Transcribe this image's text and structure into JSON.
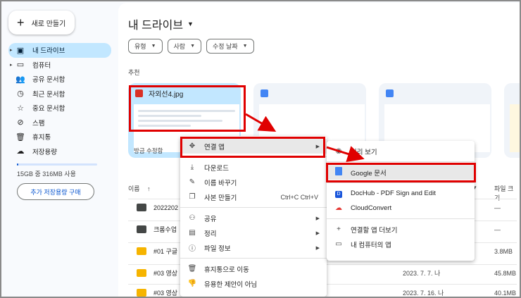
{
  "sidebar": {
    "new_button": "새로 만들기",
    "items": [
      {
        "label": "내 드라이브",
        "icon": "drive-icon"
      },
      {
        "label": "컴퓨터",
        "icon": "computer-icon"
      },
      {
        "label": "공유 문서함",
        "icon": "shared-icon"
      },
      {
        "label": "최근 문서함",
        "icon": "clock-icon"
      },
      {
        "label": "중요 문서함",
        "icon": "star-icon"
      },
      {
        "label": "스팸",
        "icon": "spam-icon"
      },
      {
        "label": "휴지통",
        "icon": "trash-icon"
      },
      {
        "label": "저장용량",
        "icon": "cloud-icon"
      }
    ],
    "storage_text": "15GB 중 316MB 사용",
    "storage_fraction": 0.021,
    "buy_button": "추가 저장용량 구매"
  },
  "main": {
    "title": "내 드라이브",
    "chips": [
      "유형",
      "사람",
      "수정 날짜"
    ],
    "suggested_label": "추천",
    "card": {
      "name": "자외선4.jpg",
      "footer": "방금 수정함"
    },
    "list_header": {
      "name": "이름",
      "owner_sort": "▾",
      "size": "파일 크기"
    },
    "rows": [
      {
        "name": "2022202",
        "type": "folder",
        "date": "",
        "size": "—"
      },
      {
        "name": "크롬수업",
        "type": "folder",
        "date": "",
        "size": "—"
      },
      {
        "name": "#01 구글",
        "type": "slide",
        "date": "",
        "size": "3.8MB"
      },
      {
        "name": "#03 영상",
        "type": "slide",
        "date": "2023. 7. 7. 나",
        "size": "45.8MB"
      },
      {
        "name": "#03 영상",
        "type": "slide",
        "date": "2023. 7. 16. 나",
        "size": "40.1MB"
      }
    ]
  },
  "context_menu": {
    "open_with": "연결 앱",
    "items": [
      {
        "label": "다운로드",
        "icon": "download-icon"
      },
      {
        "label": "이름 바꾸기",
        "icon": "rename-icon"
      },
      {
        "label": "사본 만들기",
        "icon": "copy-icon",
        "shortcut": "Ctrl+C Ctrl+V"
      },
      {
        "label": "공유",
        "icon": "share-icon",
        "submenu": true
      },
      {
        "label": "정리",
        "icon": "organize-icon",
        "submenu": true
      },
      {
        "label": "파일 정보",
        "icon": "info-icon",
        "submenu": true
      },
      {
        "label": "휴지통으로 이동",
        "icon": "trash-icon"
      },
      {
        "label": "유용한 제안이 아님",
        "icon": "thumb-down-icon"
      }
    ]
  },
  "submenu": {
    "preview": "미리 보기",
    "google_docs": "Google 문서",
    "apps": [
      "DocHub - PDF Sign and Edit",
      "CloudConvert"
    ],
    "more_apps": "연결할 앱 더보기",
    "computer_apps": "내 컴퓨터의 앱"
  },
  "colors": {
    "highlight": "#e00000",
    "active_nav": "#c2e7ff",
    "accent": "#0b57d0"
  }
}
